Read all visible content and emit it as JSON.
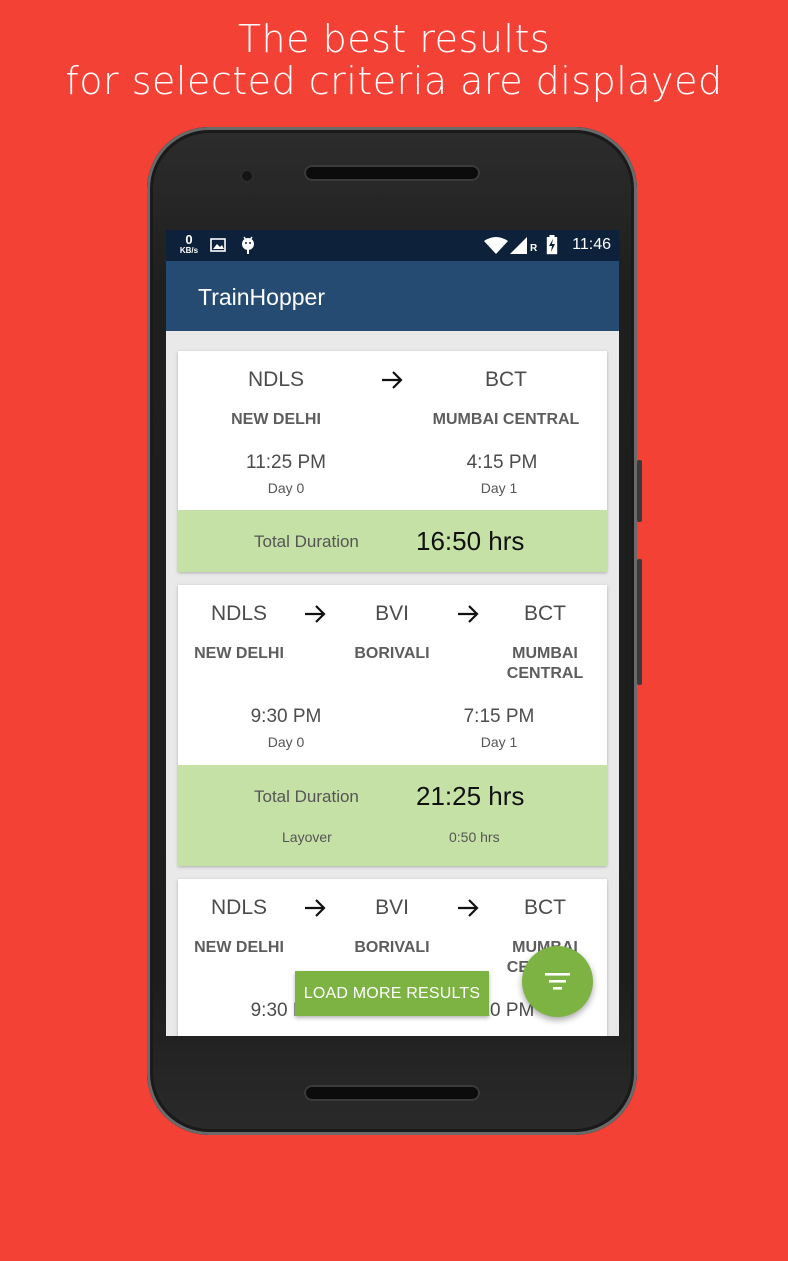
{
  "promo": {
    "line1": "The best results",
    "line2": "for selected criteria are displayed"
  },
  "status_bar": {
    "speed_value": "0",
    "speed_unit": "KB/s",
    "roaming": "R",
    "time": "11:46"
  },
  "app": {
    "title": "TrainHopper"
  },
  "results": [
    {
      "from_code": "NDLS",
      "from_name": "NEW DELHI",
      "to_code": "BCT",
      "to_name": "MUMBAI CENTRAL",
      "depart_time": "11:25 PM",
      "depart_day": "Day 0",
      "arrive_time": "4:15 PM",
      "arrive_day": "Day 1",
      "duration_label": "Total Duration",
      "duration": "16:50 hrs"
    },
    {
      "from_code": "NDLS",
      "from_name": "NEW DELHI",
      "via_code": "BVI",
      "via_name": "BORIVALI",
      "to_code": "BCT",
      "to_name_line1": "MUMBAI",
      "to_name_line2": "CENTRAL",
      "depart_time": "9:30 PM",
      "depart_day": "Day 0",
      "arrive_time": "7:15 PM",
      "arrive_day": "Day 1",
      "duration_label": "Total Duration",
      "duration": "21:25 hrs",
      "layover_label": "Layover",
      "layover": "0:50 hrs"
    },
    {
      "from_code": "NDLS",
      "from_name": "NEW DELHI",
      "via_code": "BVI",
      "via_name": "BORIVALI",
      "to_code": "BCT",
      "to_name_line1": "MUMBAI",
      "to_name_line2": "CENTRAL",
      "depart_time": "9:30 PM",
      "arrive_time": "8:10 PM"
    }
  ],
  "load_more_label": "LOAD MORE RESULTS",
  "colors": {
    "background": "#f44136",
    "app_bar": "#254b73",
    "status_bar": "#0d213a",
    "duration_band": "#c5e1a5",
    "accent_green": "#7cb342"
  },
  "icons": [
    "data-speed-icon",
    "image-notification-icon",
    "android-debug-icon",
    "wifi-icon",
    "signal-icon",
    "battery-charging-icon",
    "arrow-right-icon",
    "filter-sort-icon"
  ]
}
